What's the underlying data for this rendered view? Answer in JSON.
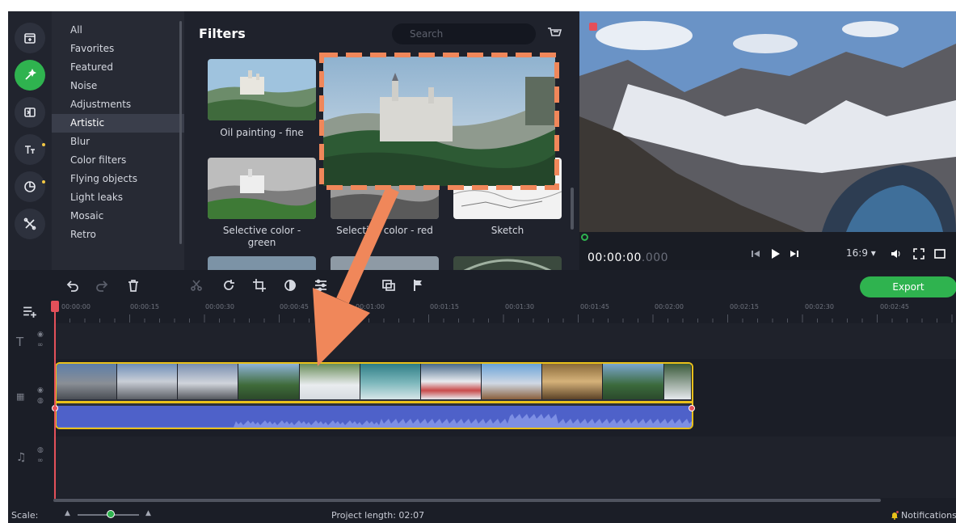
{
  "sidebar": {
    "tools": [
      {
        "icon": "import-icon"
      },
      {
        "icon": "magic-wand-icon",
        "active": true
      },
      {
        "icon": "transitions-icon"
      },
      {
        "icon": "titles-icon"
      },
      {
        "icon": "stickers-icon"
      },
      {
        "icon": "more-tools-icon"
      }
    ],
    "categories": [
      "All",
      "Favorites",
      "Featured",
      "Noise",
      "Adjustments",
      "Artistic",
      "Blur",
      "Color filters",
      "Flying objects",
      "Light leaks",
      "Mosaic",
      "Retro"
    ],
    "active_category": "Artistic"
  },
  "filters": {
    "title": "Filters",
    "search_placeholder": "Search",
    "tiles": [
      {
        "label": "Oil painting - fine"
      },
      {
        "label": "Selective color - green"
      },
      {
        "label": "Selective color - red"
      },
      {
        "label": "Sketch"
      }
    ]
  },
  "preview": {
    "timecode": "00:00:00",
    "timecode_ms": ".000",
    "aspect": "16:9 ▾"
  },
  "toolbar": {
    "export_label": "Export"
  },
  "ruler": {
    "labels": [
      "00:00:00",
      "00:00:15",
      "00:00:30",
      "00:00:45",
      "00:01:00",
      "00:01:15",
      "00:01:30",
      "00:01:45",
      "00:02:00",
      "00:02:15",
      "00:02:30",
      "00:02:45"
    ]
  },
  "status": {
    "scale_label": "Scale:",
    "project_length": "Project length: 02:07",
    "notifications": "Notifications"
  },
  "colors": {
    "accent": "#2fb34f",
    "annotation": "#f0875a",
    "clip_border": "#e9c01a",
    "audio": "#4e61c9",
    "playhead": "#e4505a"
  }
}
